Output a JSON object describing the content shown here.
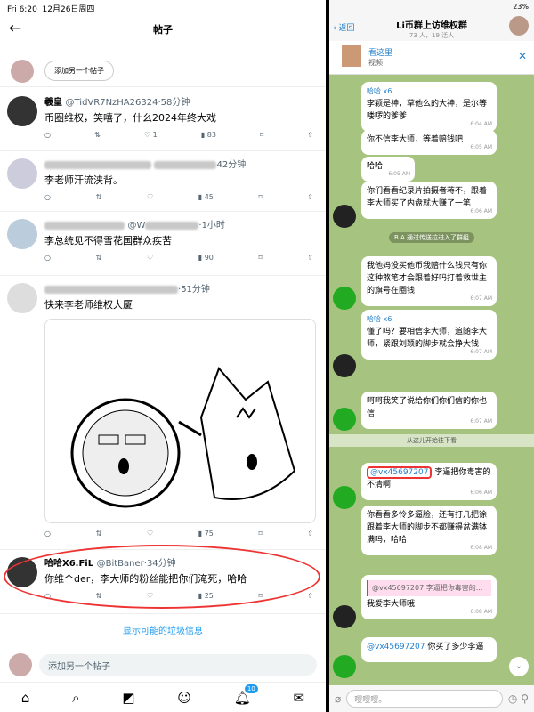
{
  "status_left": {
    "time": "Fri 6:20",
    "date": "12月26日周四"
  },
  "status_right": {
    "battery": "23%"
  },
  "left": {
    "title": "帖子",
    "add_post_pill": "添加另一个帖子",
    "tweets": [
      {
        "name": "羲皇",
        "handle": "@TidVR7NzHA26324",
        "time": "58分钟",
        "text": "币圈维权，笑嘻了，什么2024年终大戏",
        "likes": "1",
        "views": "83"
      },
      {
        "name": "",
        "handle": "",
        "time": "42分钟",
        "text": "李老师汗流浃背。",
        "views": "45"
      },
      {
        "name": "",
        "handle": "@W",
        "time": "1小时",
        "text": "李总统见不得雪花国群众疾苦",
        "views": "90"
      },
      {
        "name": "",
        "handle": "",
        "time": "51分钟",
        "text": "快来李老师维权大厦",
        "views": "75"
      },
      {
        "name": "哈哈X6.FiL",
        "handle": "@BitBaner",
        "time": "34分钟",
        "text": "你维个der，李大师的粉丝能把你们淹死，哈哈",
        "views": "25"
      }
    ],
    "spam_link": "显示可能的垃圾信息",
    "compose_placeholder": "添加另一个帖子",
    "notif_badge": "10"
  },
  "right": {
    "back": "返回",
    "title": "Li币群上访维权群",
    "subtitle": "73 人，19 活人",
    "pinned_title": "看这里",
    "pinned_sub": "视频",
    "messages": [
      {
        "sender": "哈哈 x6",
        "text": "李颖是神，草他么的大神，是尔等喽啰的爹爹",
        "time": "6:04 AM"
      },
      {
        "text": "你不信李大师，等着赔钱吧",
        "time": "6:05 AM"
      },
      {
        "text": "哈哈",
        "time": "6:05 AM"
      },
      {
        "text": "你们看看纪录片拍摄者蒋不，跟着李大师买了内盘就大赚了一笔",
        "time": "6:06 AM"
      },
      {
        "text": "我他妈没买他币我赔什么钱只有你这种煞笔才会跟着好吗打着救世主的旗号在圈钱",
        "time": "6:07 AM"
      },
      {
        "sender": "哈哈 x6",
        "text": "懂了吗？要相信李大师，追随李大师，紧跟刘颖的脚步就会挣大钱",
        "time": "6:07 AM"
      },
      {
        "text": "呵呵我笑了说给你们你们信的你也信",
        "time": "6:07 AM"
      },
      {
        "mention": "@vx45697207",
        "text": "李逼把你毒害的不清啊",
        "time": "6:06 AM"
      },
      {
        "text": "你看看多怜多逼脸，还有打几把徐跟着李大师的脚步不都赚得盆满钵满吗，哈哈",
        "time": "6:08 AM"
      },
      {
        "quote": "@vx45697207 李逼把你毒害的...",
        "text": "我爱李大师哦",
        "time": "6:08 AM"
      },
      {
        "mention": "@vx45697207",
        "text": "你买了多少李逼",
        "time": ""
      }
    ],
    "system_msg": "B A 通过传送拉进入了群组",
    "unread_marker": "从这儿开始往下看",
    "input_placeholder": "嘤嘤嘤。"
  }
}
